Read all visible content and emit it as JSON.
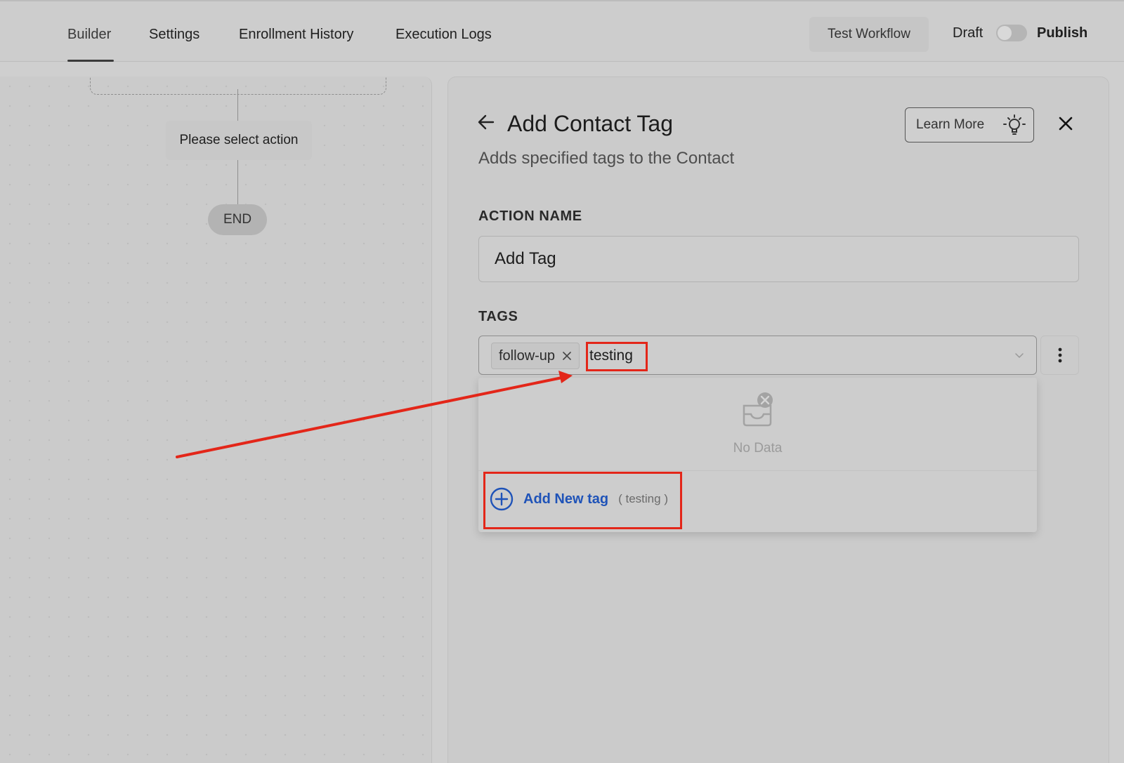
{
  "nav": {
    "tabs": [
      {
        "label": "Builder"
      },
      {
        "label": "Settings"
      },
      {
        "label": "Enrollment History"
      },
      {
        "label": "Execution Logs"
      }
    ],
    "test_workflow": "Test Workflow",
    "draft": "Draft",
    "publish": "Publish"
  },
  "canvas": {
    "action_node": "Please select action",
    "end_node": "END"
  },
  "panel": {
    "title": "Add Contact Tag",
    "subtitle": "Adds specified tags to the Contact",
    "learn_more": "Learn More",
    "action_name_label": "ACTION NAME",
    "action_name_value": "Add Tag",
    "tags_label": "TAGS",
    "tags": [
      {
        "label": "follow-up"
      }
    ],
    "typed_tag": "testing",
    "dropdown": {
      "empty_text": "No Data",
      "add_label": "Add New tag",
      "add_hint": "( testing )"
    }
  },
  "colors": {
    "accent": "#1f53b8",
    "highlight": "#e32619"
  }
}
